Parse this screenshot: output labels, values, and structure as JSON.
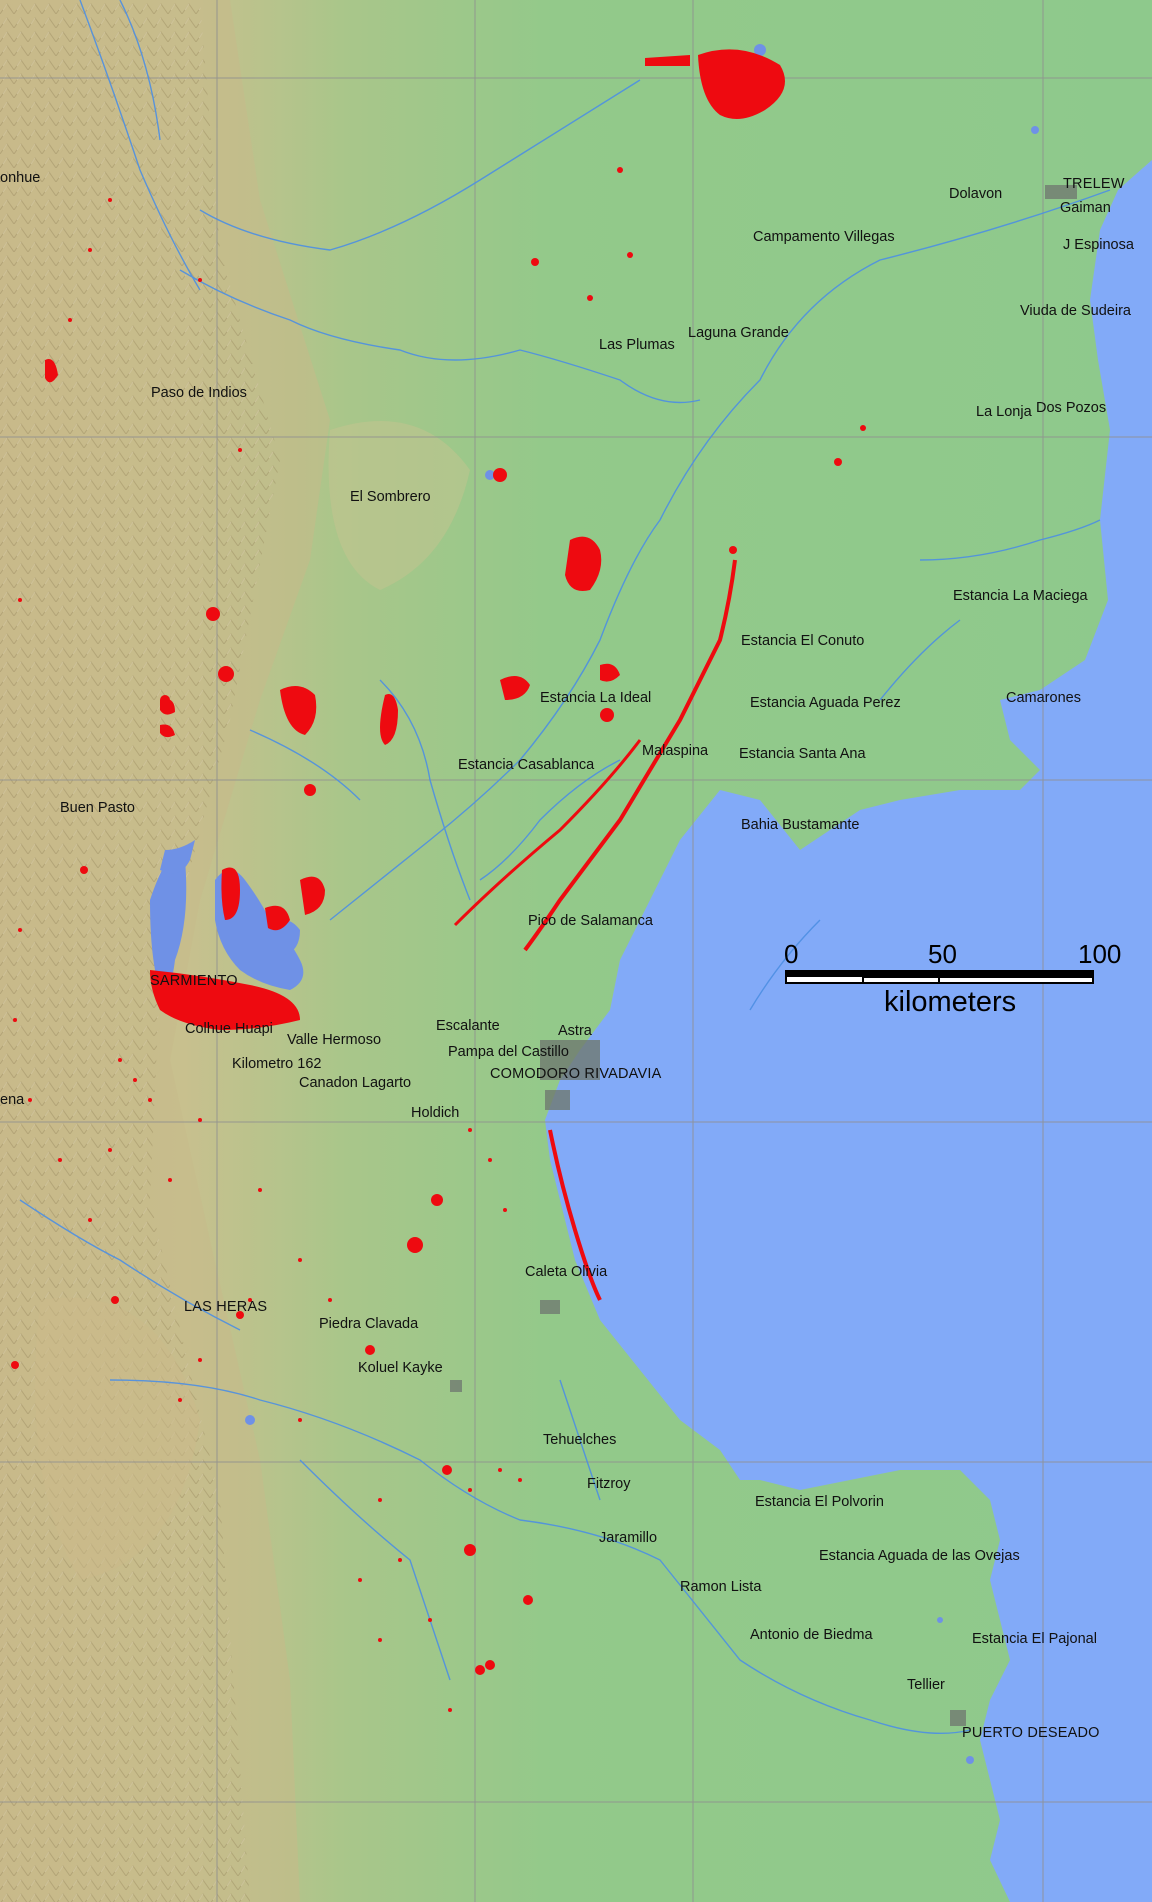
{
  "map": {
    "colors": {
      "sea": "#82aaf8",
      "lowland": "#8fc98a",
      "upland": "#c6c08e",
      "flood": "#ee0a10",
      "water": "#6f91e6",
      "river": "#4d8fe3",
      "grid": "#8f8f8f",
      "urban": "#707a70"
    },
    "places": [
      {
        "name": "onhue"
      },
      {
        "name": "Dolavon"
      },
      {
        "name": "TRELEW"
      },
      {
        "name": "Gaiman"
      },
      {
        "name": "Campamento Villegas"
      },
      {
        "name": "J Espinosa"
      },
      {
        "name": "Viuda de Sudeira"
      },
      {
        "name": "Laguna Grande"
      },
      {
        "name": "Las Plumas"
      },
      {
        "name": "Paso de Indios"
      },
      {
        "name": "La Lonja"
      },
      {
        "name": "Dos Pozos"
      },
      {
        "name": "El Sombrero"
      },
      {
        "name": "Estancia La Maciega"
      },
      {
        "name": "Estancia El Conuto"
      },
      {
        "name": "Estancia La Ideal"
      },
      {
        "name": "Estancia Aguada Perez"
      },
      {
        "name": "Camarones"
      },
      {
        "name": "Malaspina"
      },
      {
        "name": "Estancia Santa Ana"
      },
      {
        "name": "Estancia Casablanca"
      },
      {
        "name": "Buen Pasto"
      },
      {
        "name": "Bahia Bustamante"
      },
      {
        "name": "Pico de Salamanca"
      },
      {
        "name": "SARMIENTO"
      },
      {
        "name": "Colhue Huapi"
      },
      {
        "name": "Escalante"
      },
      {
        "name": "Astra"
      },
      {
        "name": "Valle Hermoso"
      },
      {
        "name": "Pampa del Castillo"
      },
      {
        "name": "Kilometro 162"
      },
      {
        "name": "COMODORO RIVADAVIA"
      },
      {
        "name": "Canadon Lagarto"
      },
      {
        "name": "ena"
      },
      {
        "name": "Holdich"
      },
      {
        "name": "Caleta Olivia"
      },
      {
        "name": "LAS HERAS"
      },
      {
        "name": "Piedra Clavada"
      },
      {
        "name": "Koluel Kayke"
      },
      {
        "name": "Tehuelches"
      },
      {
        "name": "Fitzroy"
      },
      {
        "name": "Estancia El Polvorin"
      },
      {
        "name": "Jaramillo"
      },
      {
        "name": "Estancia Aguada de las Ovejas"
      },
      {
        "name": "Ramon Lista"
      },
      {
        "name": "Antonio de Biedma"
      },
      {
        "name": "Estancia El Pajonal"
      },
      {
        "name": "Tellier"
      },
      {
        "name": "PUERTO DESEADO"
      }
    ],
    "scale": {
      "ticks": [
        "0",
        "50",
        "100"
      ],
      "unit": "kilometers"
    }
  }
}
